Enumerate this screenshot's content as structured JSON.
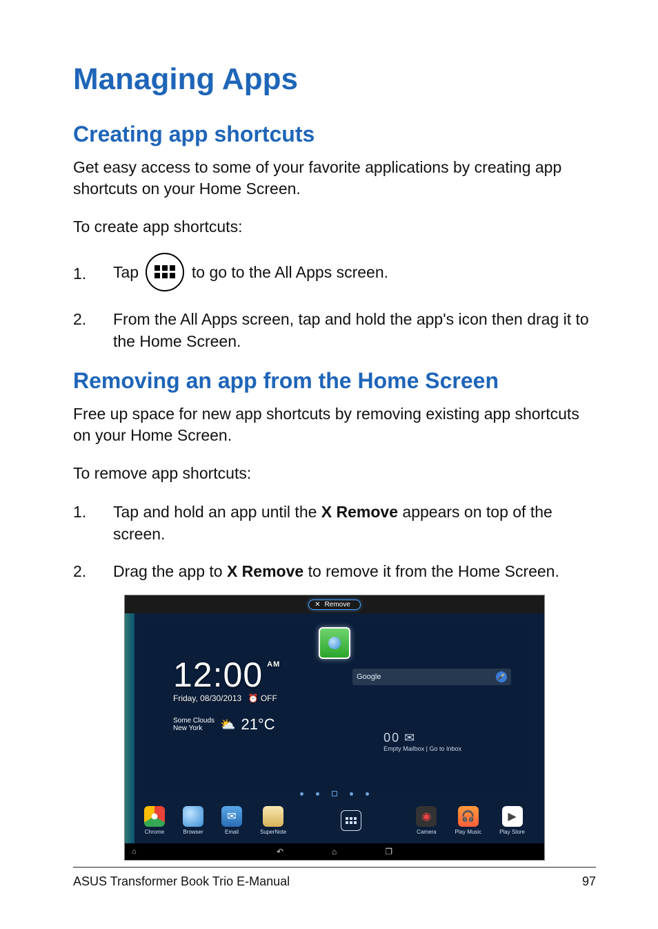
{
  "title": "Managing Apps",
  "section1": {
    "heading": "Creating app shortcuts",
    "intro": "Get easy access to some of your favorite applications by creating app shortcuts on your Home Screen.",
    "lead": "To create app shortcuts:",
    "steps": {
      "s1_pre": "Tap ",
      "s1_post": " to go to the All Apps screen.",
      "s2": "From the All Apps screen, tap and hold the app's icon then drag it to the Home Screen."
    }
  },
  "section2": {
    "heading": "Removing an app from the Home Screen",
    "intro": "Free up space for new app shortcuts by removing existing app shortcuts on your Home Screen.",
    "lead": "To remove app shortcuts:",
    "steps": {
      "s1_pre": "Tap and hold an app until the ",
      "s1_bold": "X Remove",
      "s1_post": " appears on top of the screen.",
      "s2_pre": "Drag the app to ",
      "s2_bold": "X Remove",
      "s2_post": " to remove it from the Home Screen."
    }
  },
  "screenshot": {
    "remove_label": "Remove",
    "clock": {
      "time": "12:00",
      "ampm": "AM",
      "date": "Friday, 08/30/2013",
      "alarm": "OFF"
    },
    "weather": {
      "line1": "Some Clouds",
      "line2": "New York",
      "temp": "21°C"
    },
    "search_placeholder": "Google",
    "inbox": {
      "count": "00",
      "line1": "Empty Mailbox",
      "line2": "Go to Inbox"
    },
    "dock": {
      "chrome": "Chrome",
      "browser": "Browser",
      "email": "Email",
      "supernote": "SuperNote",
      "camera": "Camera",
      "playmusic": "Play Music",
      "playstore": "Play Store"
    }
  },
  "footer": {
    "left": "ASUS Transformer Book Trio E-Manual",
    "right": "97"
  }
}
